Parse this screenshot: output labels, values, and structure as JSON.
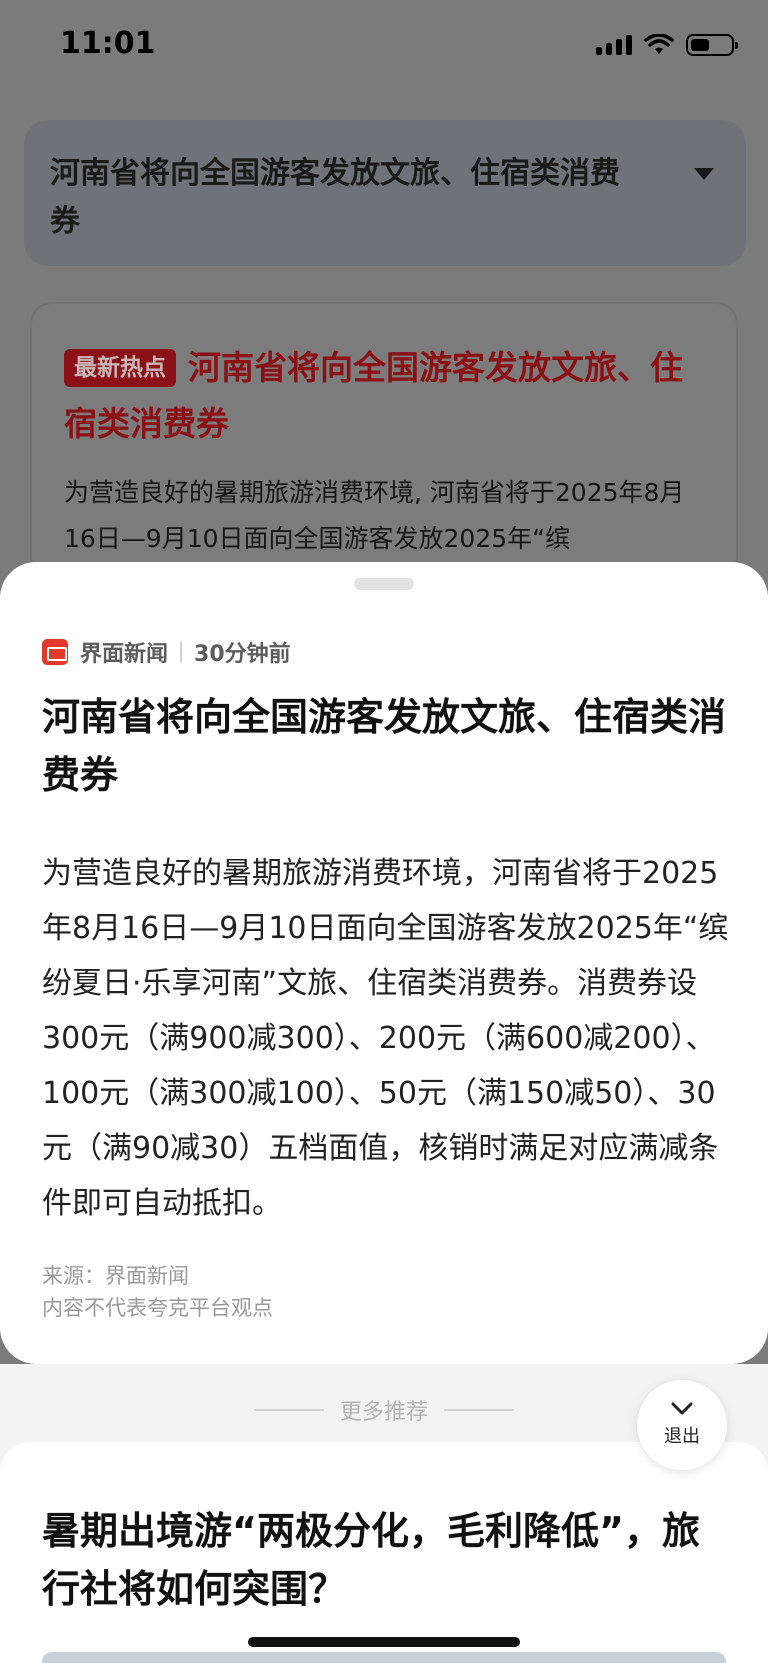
{
  "status": {
    "time": "11:01"
  },
  "topic": {
    "title": "河南省将向全国游客发放文旅、住宿类消费券"
  },
  "background_card": {
    "badge": "最新热点",
    "headline": "河南省将向全国游客发放文旅、住宿类消费券",
    "snippet": "为营造良好的暑期旅游消费环境, 河南省将于2025年8月16日—9月10日面向全国游客发放2025年“缤"
  },
  "sheet": {
    "source": "界面新闻",
    "time_ago": "30分钟前",
    "title": "河南省将向全国游客发放文旅、住宿类消费券",
    "body": "为营造良好的暑期旅游消费环境，河南省将于2025年8月16日—9月10日面向全国游客发放2025年“缤纷夏日·乐享河南”文旅、住宿类消费券。消费券设300元（满900减300）、200元（满600减200）、100元（满300减100）、50元（满150减50）、30元（满90减30）五档面值，核销时满足对应满减条件即可自动抵扣。",
    "footnote_source": "来源：界面新闻",
    "footnote_disclaimer": "内容不代表夸克平台观点"
  },
  "more": {
    "label": "更多推荐",
    "exit_label": "退出",
    "next_title": "暑期出境游“两极分化，毛利降低”，旅行社将如何突围？"
  },
  "colors": {
    "accent_red": "#8b1117",
    "logo_red": "#e13a2b"
  }
}
